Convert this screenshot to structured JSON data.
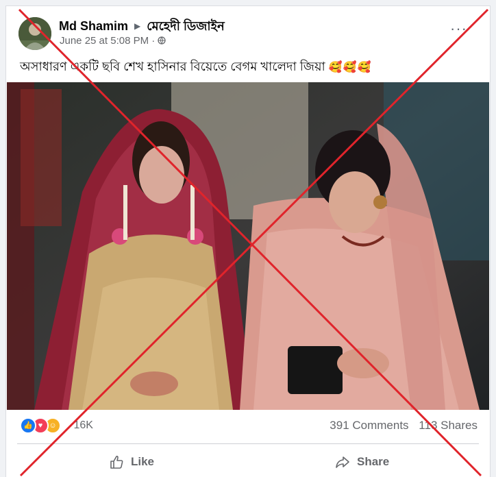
{
  "post": {
    "author": "Md Shamim",
    "group": "মেহেদী ডিজাইন",
    "date": "June 25 at 5:08 PM",
    "privacy_separator": "·",
    "caption": "অসাধারণ একটি ছবি শেখ হাসিনার বিয়েতে বেগম খালেদা জিয়া",
    "caption_emojis": "🥰🥰🥰"
  },
  "reactions": {
    "types": [
      "like-icon",
      "love-icon",
      "care-icon"
    ],
    "count": "16K"
  },
  "engagement": {
    "comments": "391 Comments",
    "shares": "113 Shares"
  },
  "actions": {
    "like_label": "Like",
    "share_label": "Share"
  },
  "colors": {
    "like_blue": "#1877f2",
    "love_red": "#f33e58",
    "care_yellow": "#f7b125",
    "overlay_red": "#e0242b"
  }
}
